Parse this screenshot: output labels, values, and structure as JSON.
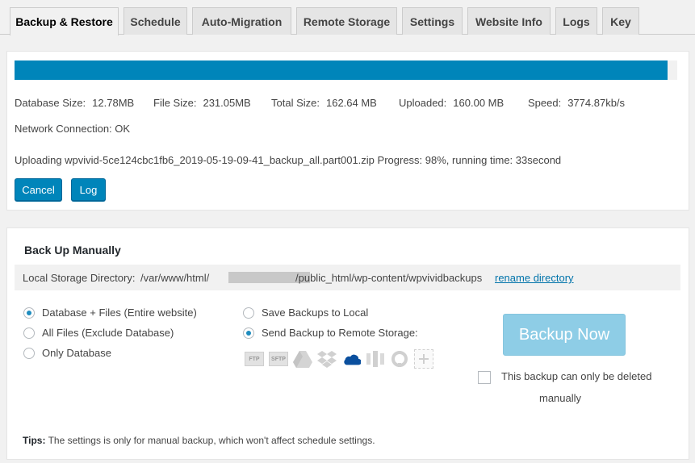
{
  "tabs": [
    {
      "label": "Backup & Restore",
      "active": true
    },
    {
      "label": "Schedule"
    },
    {
      "label": "Auto-Migration"
    },
    {
      "label": "Remote Storage"
    },
    {
      "label": "Settings"
    },
    {
      "label": "Website Info"
    },
    {
      "label": "Logs"
    },
    {
      "label": "Key"
    }
  ],
  "progress": {
    "fraction": 0.985,
    "color": "#0085ba",
    "stats": {
      "database_size_label": "Database Size:",
      "database_size_value": "12.78MB",
      "file_size_label": "File Size:",
      "file_size_value": "231.05MB",
      "total_size_label": "Total Size:",
      "total_size_value": "162.64 MB",
      "uploaded_label": "Uploaded:",
      "uploaded_value": "160.00 MB",
      "speed_label": "Speed:",
      "speed_value": "3774.87kb/s"
    },
    "network_label": "Network Connection:",
    "network_value": "OK",
    "status_text": "Uploading wpvivid-5ce124cbc1fb6_2019-05-19-09-41_backup_all.part001.zip Progress: 98%, running time: 33second",
    "cancel_label": "Cancel",
    "log_label": "Log"
  },
  "manual": {
    "title": "Back Up Manually",
    "dir_label": "Local Storage Directory:",
    "dir_prefix": "/var/www/html/",
    "dir_suffix": "/public_html/wp-content/wpvividbackups",
    "rename_link": "rename directory",
    "backup_options": [
      {
        "label": "Database + Files (Entire website)",
        "checked": true
      },
      {
        "label": "All Files (Exclude Database)",
        "checked": false
      },
      {
        "label": "Only Database",
        "checked": false
      }
    ],
    "storage_options": [
      {
        "label": "Save Backups to Local",
        "checked": false
      },
      {
        "label": "Send Backup to Remote Storage:",
        "checked": true
      }
    ],
    "storage_icons": {
      "ftp": "FTP",
      "sftp": "SFTP"
    },
    "backup_now_label": "Backup Now",
    "delete_note_line1": "This backup can only be deleted",
    "delete_note_line2": "manually",
    "tips_label": "Tips:",
    "tips_text": " The settings is only for manual backup, which won't affect schedule settings."
  }
}
